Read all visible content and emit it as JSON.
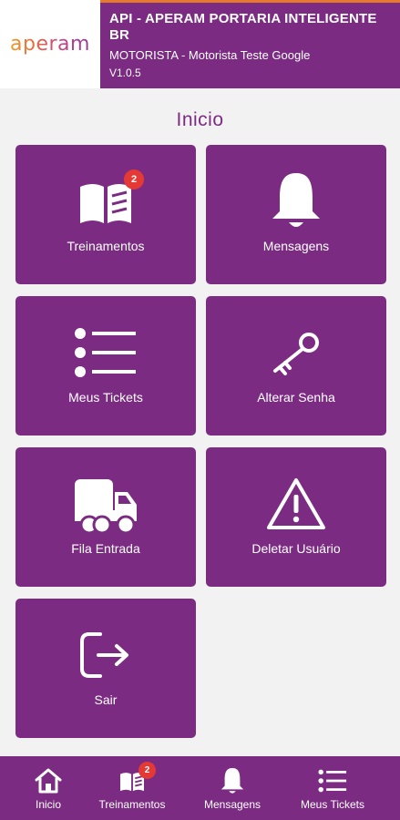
{
  "header": {
    "logo_text": "aperam",
    "title": "API - APERAM PORTARIA INTELIGENTE BR",
    "user": "MOTORISTA -  Motorista Teste Google",
    "version": "V1.0.5",
    "accent_color": "#e5792c",
    "brand_color": "#7b2c82"
  },
  "page": {
    "title": "Inicio"
  },
  "tiles": [
    {
      "label": "Treinamentos",
      "icon": "book-icon",
      "badge": "2"
    },
    {
      "label": "Mensagens",
      "icon": "bell-icon"
    },
    {
      "label": "Meus Tickets",
      "icon": "list-icon"
    },
    {
      "label": "Alterar Senha",
      "icon": "key-icon"
    },
    {
      "label": "Fila Entrada",
      "icon": "truck-icon"
    },
    {
      "label": "Deletar Usuário",
      "icon": "warning-icon"
    },
    {
      "label": "Sair",
      "icon": "logout-icon"
    }
  ],
  "bottom_nav": [
    {
      "label": "Inicio",
      "icon": "home-icon"
    },
    {
      "label": "Treinamentos",
      "icon": "book-icon",
      "badge": "2"
    },
    {
      "label": "Mensagens",
      "icon": "bell-icon"
    },
    {
      "label": "Meus Tickets",
      "icon": "list-icon"
    }
  ],
  "badge_color": "#e53935"
}
